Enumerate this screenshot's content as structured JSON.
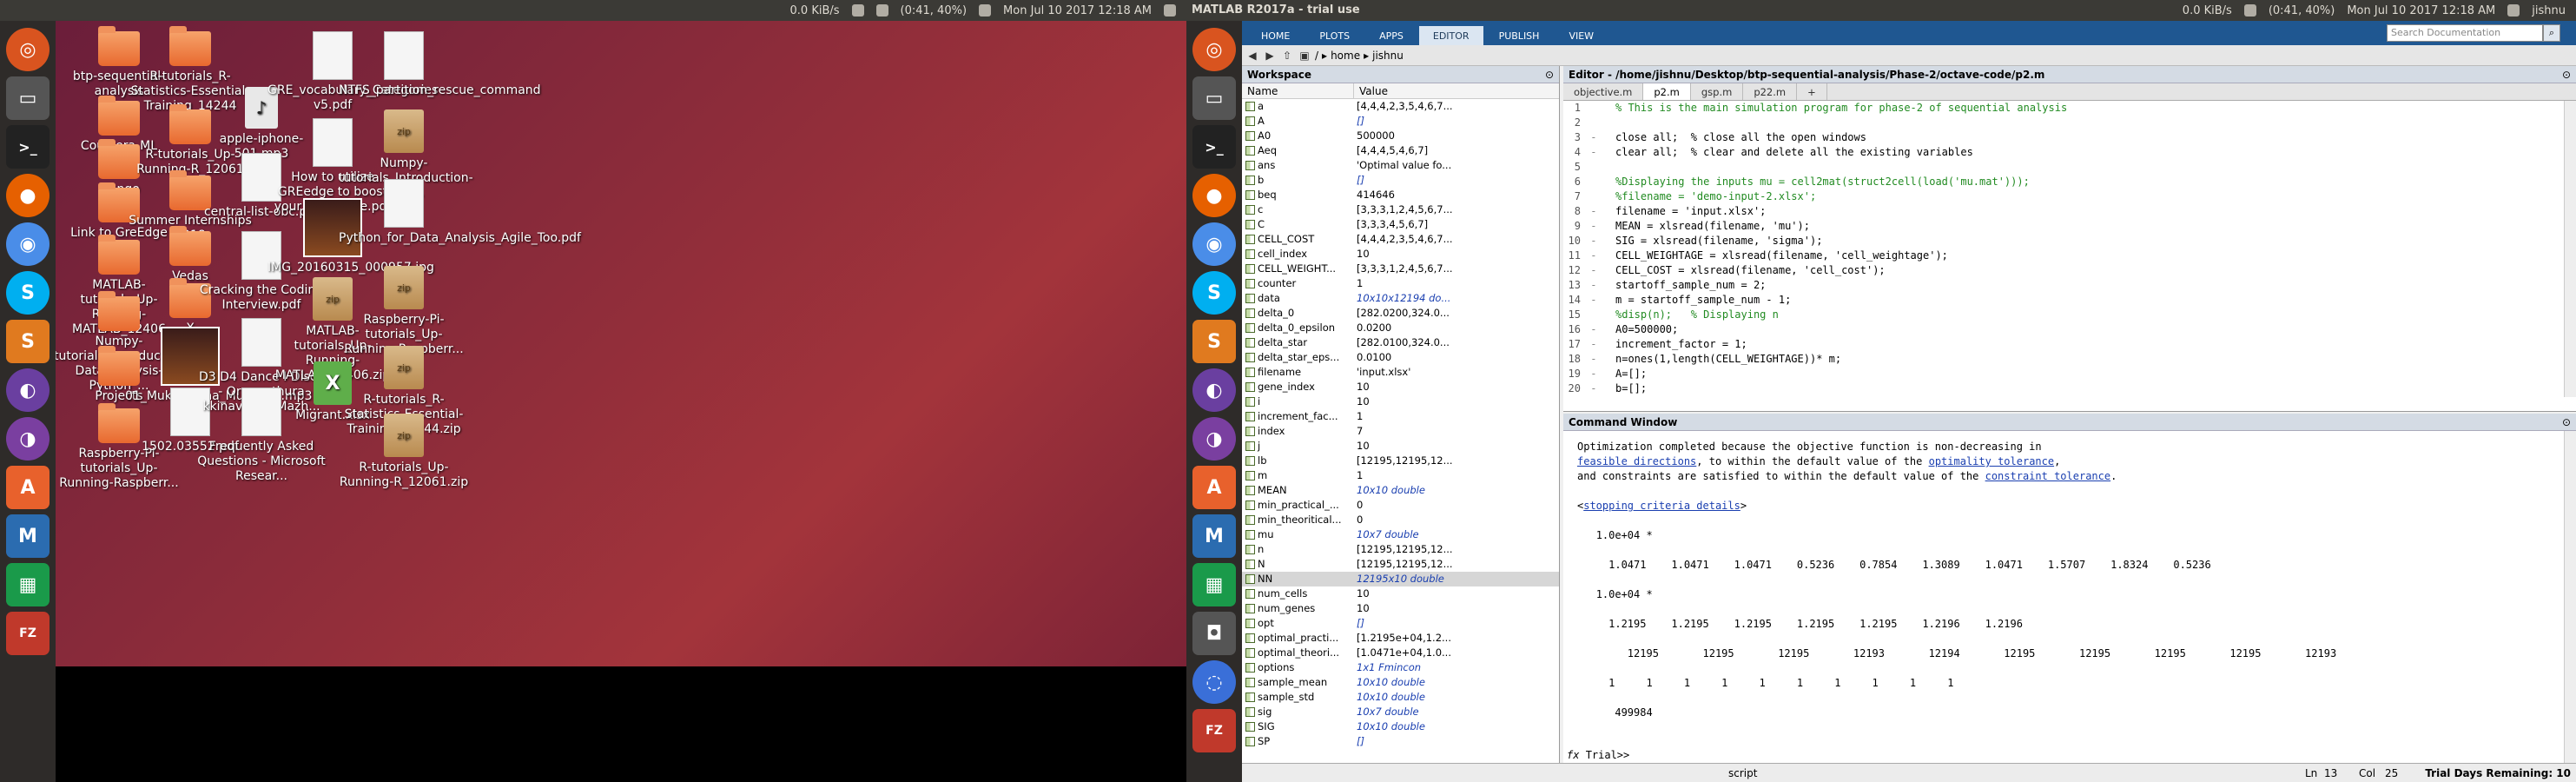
{
  "monitor1": {
    "topbar": {
      "net": "0.0 KiB/s",
      "battery": "(0:41, 40%)",
      "datetime": "Mon Jul 10 2017 12:18 AM"
    },
    "desktop_icons": [
      {
        "label": "btp-sequential-analysis",
        "type": "folder"
      },
      {
        "label": "Coursera-ML",
        "type": "folder"
      },
      {
        "label": "django",
        "type": "folder"
      },
      {
        "label": "Link to GreEdge",
        "type": "folder"
      },
      {
        "label": "MATLAB-tutorials_Up-Running-MATLAB_12406",
        "type": "folder"
      },
      {
        "label": "Numpy-tutorials_Introduction-Data-Analysis-Python_...",
        "type": "folder"
      },
      {
        "label": "Projects",
        "type": "folder"
      },
      {
        "label": "Raspberry-Pi-tutorials_Up-Running-Raspberr...",
        "type": "folder"
      },
      {
        "label": "R-tutorials_R-Statistics-Essential-Training_14244",
        "type": "folder"
      },
      {
        "label": "R-tutorials_Up-Running-R_12061",
        "type": "folder"
      },
      {
        "label": "Summer Internships 2018",
        "type": "folder"
      },
      {
        "label": "Vedas",
        "type": "folder"
      },
      {
        "label": "X",
        "type": "folder"
      },
      {
        "label": "01_Mukil_Varna_Mukunda.mp3",
        "type": "image"
      },
      {
        "label": "1502.03552.pdf",
        "type": "file"
      },
      {
        "label": "apple-iphone-501.mp3",
        "type": "mp3"
      },
      {
        "label": "central-list-obc.pdf",
        "type": "file"
      },
      {
        "label": "Cracking the Coding Interview.pdf",
        "type": "file"
      },
      {
        "label": "D3 D4 Dance I Disco - Oru mathura kkinavin... I Mazh...",
        "type": "file"
      },
      {
        "label": "Frequently Asked Questions - Microsoft Resear...",
        "type": "file"
      },
      {
        "label": "GRE_vocabulary_Categories v5.pdf",
        "type": "file"
      },
      {
        "label": "How to utilize GREedge to boost your GRE score.pdf",
        "type": "file"
      },
      {
        "label": "IMG_20160315_000957.jpg",
        "type": "image"
      },
      {
        "label": "MATLAB-tutorials_Up-Running-MATLAB_12406.zip",
        "type": "zip"
      },
      {
        "label": "Migrant.xlsx",
        "type": "xlsx"
      },
      {
        "label": "NTFS_partition_rescue_command",
        "type": "file"
      },
      {
        "label": "Numpy-tutorials_Introduction-Data...",
        "type": "zip"
      },
      {
        "label": "Python_for_Data_Analysis_Agile_Too.pdf",
        "type": "file"
      },
      {
        "label": "Raspberry-Pi-tutorials_Up-Running-Raspberr...",
        "type": "zip"
      },
      {
        "label": "R-tutorials_R-Statistics-Essential-Training_14244.zip",
        "type": "zip"
      },
      {
        "label": "R-tutorials_Up-Running-R_12061.zip",
        "type": "zip"
      }
    ]
  },
  "monitor2": {
    "topbar": {
      "title": "MATLAB R2017a - trial use",
      "net": "0.0 KiB/s",
      "battery": "(0:41, 40%)",
      "datetime": "Mon Jul 10 2017 12:18 AM",
      "user": "jishnu"
    },
    "ribbon_tabs": [
      "HOME",
      "PLOTS",
      "APPS",
      "EDITOR",
      "PUBLISH",
      "VIEW"
    ],
    "search_placeholder": "Search Documentation",
    "path": [
      "home",
      "jishnu"
    ],
    "workspace": {
      "title": "Workspace",
      "col_name": "Name",
      "col_value": "Value",
      "rows": [
        [
          "a",
          "[4,4,4,2,3,5,4,6,7..."
        ],
        [
          "A",
          "[]"
        ],
        [
          "A0",
          "500000"
        ],
        [
          "Aeq",
          "[4,4,4,5,4,6,7]"
        ],
        [
          "ans",
          "'Optimal value fo..."
        ],
        [
          "b",
          "[]"
        ],
        [
          "beq",
          "414646"
        ],
        [
          "c",
          "[3,3,3,1,2,4,5,6,7..."
        ],
        [
          "C",
          "[3,3,3,4,5,6,7]"
        ],
        [
          "CELL_COST",
          "[4,4,4,2,3,5,4,6,7..."
        ],
        [
          "cell_index",
          "10"
        ],
        [
          "CELL_WEIGHT...",
          "[3,3,3,1,2,4,5,6,7..."
        ],
        [
          "counter",
          "1"
        ],
        [
          "data",
          "10x10x12194 do..."
        ],
        [
          "delta_0",
          "[282.0200,324.0..."
        ],
        [
          "delta_0_epsilon",
          "0.0200"
        ],
        [
          "delta_star",
          "[282.0100,324.0..."
        ],
        [
          "delta_star_eps...",
          "0.0100"
        ],
        [
          "filename",
          "'input.xlsx'"
        ],
        [
          "gene_index",
          "10"
        ],
        [
          "i",
          "10"
        ],
        [
          "increment_fac...",
          "1"
        ],
        [
          "index",
          "7"
        ],
        [
          "j",
          "10"
        ],
        [
          "lb",
          "[12195,12195,12..."
        ],
        [
          "m",
          "1"
        ],
        [
          "MEAN",
          "10x10 double"
        ],
        [
          "min_practical_...",
          "0"
        ],
        [
          "min_theoritical...",
          "0"
        ],
        [
          "mu",
          "10x7 double"
        ],
        [
          "n",
          "[12195,12195,12..."
        ],
        [
          "N",
          "[12195,12195,12..."
        ],
        [
          "NN",
          "12195x10 double"
        ],
        [
          "num_cells",
          "10"
        ],
        [
          "num_genes",
          "10"
        ],
        [
          "opt",
          "[]"
        ],
        [
          "optimal_practi...",
          "[1.2195e+04,1.2..."
        ],
        [
          "optimal_theori...",
          "[1.0471e+04,1.0..."
        ],
        [
          "options",
          "1x1 Fmincon"
        ],
        [
          "sample_mean",
          "10x10 double"
        ],
        [
          "sample_std",
          "10x10 double"
        ],
        [
          "sig",
          "10x7 double"
        ],
        [
          "SIG",
          "10x10 double"
        ],
        [
          "SP",
          "[]"
        ]
      ]
    },
    "editor": {
      "title": "Editor - /home/jishnu/Desktop/btp-sequential-analysis/Phase-2/octave-code/p2.m",
      "tabs": [
        "objective.m",
        "p2.m",
        "gsp.m",
        "p22.m",
        "+"
      ],
      "lines": [
        "% This is the main simulation program for phase-2 of sequential analysis",
        "",
        "close all;  % close all the open windows",
        "clear all;  % clear and delete all the existing variables",
        "",
        "%Displaying the inputs mu = cell2mat(struct2cell(load('mu.mat')));",
        "%filename = 'demo-input-2.xlsx';",
        "filename = 'input.xlsx';",
        "MEAN = xlsread(filename, 'mu');",
        "SIG = xlsread(filename, 'sigma');",
        "CELL_WEIGHTAGE = xlsread(filename, 'cell_weightage');",
        "CELL_COST = xlsread(filename, 'cell_cost');",
        "startoff_sample_num = 2;",
        "m = startoff_sample_num - 1;",
        "%disp(n);   % Displaying n",
        "A0=500000;",
        "increment_factor = 1;",
        "n=ones(1,length(CELL_WEIGHTAGE))* m;",
        "A=[];",
        "b=[];"
      ]
    },
    "command_window": {
      "title": "Command Window",
      "msg1": "Optimization completed because the objective function is non-decreasing in",
      "link1": "feasible directions",
      "msg2": ", to within the default value of the ",
      "link2": "optimality tolerance",
      "msg3": "and constraints are satisfied to within the default value of the ",
      "link3": "constraint tolerance",
      "link4": "stopping criteria details",
      "scale1": "1.0e+04 *",
      "row1": "1.0471    1.0471    1.0471    0.5236    0.7854    1.3089    1.0471    1.5707    1.8324    0.5236",
      "scale2": "1.0e+04 *",
      "row2": "1.2195    1.2195    1.2195    1.2195    1.2195    1.2196    1.2196",
      "row3": "12195       12195       12195       12193       12194       12195       12195       12195       12195       12193",
      "row4": "1     1     1     1     1     1     1     1     1     1",
      "row5": "499984",
      "prompt": "Trial>>"
    },
    "status": {
      "mode": "script",
      "ln_label": "Ln",
      "ln": "13",
      "col_label": "Col",
      "col": "25",
      "trial": "Trial Days Remaining: 10"
    }
  }
}
